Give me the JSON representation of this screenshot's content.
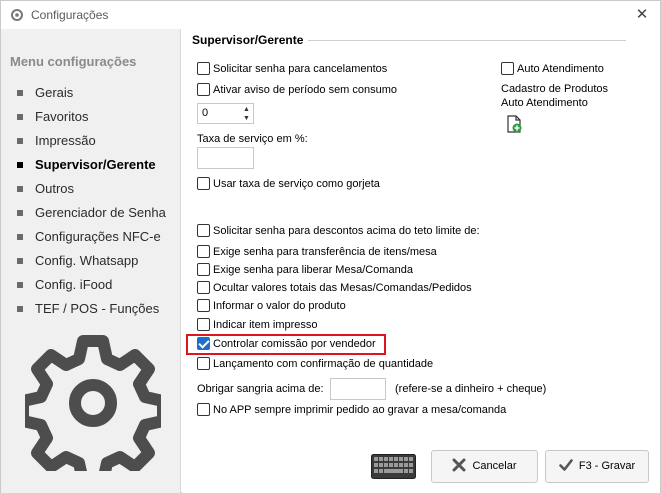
{
  "window": {
    "title": "Configurações",
    "close_glyph": "✕"
  },
  "sidebar": {
    "title": "Menu configurações",
    "items": [
      {
        "label": "Gerais"
      },
      {
        "label": "Favoritos"
      },
      {
        "label": "Impressão"
      },
      {
        "label": "Supervisor/Gerente",
        "active": true
      },
      {
        "label": "Outros"
      },
      {
        "label": "Gerenciador de Senha"
      },
      {
        "label": "Configurações NFC-e"
      },
      {
        "label": "Config. Whatsapp"
      },
      {
        "label": "Config. iFood"
      },
      {
        "label": "TEF / POS - Funções"
      }
    ]
  },
  "main": {
    "section_title": "Supervisor/Gerente",
    "opt_cancel": "Solicitar senha para cancelamentos",
    "opt_period": "Ativar aviso de período sem consumo",
    "period_value": "0",
    "service_rate_label": "Taxa de serviço em %:",
    "service_rate_value": "",
    "opt_tip": "Usar taxa de serviço como gorjeta",
    "opt_auto": "Auto Atendimento",
    "product_reg_line1": "Cadastro de Produtos",
    "product_reg_line2": "Auto Atendimento",
    "opt_discount": "Solicitar senha para descontos acima do teto limite de:",
    "opt_transfer": "Exige senha para transferência de itens/mesa",
    "opt_release": "Exige senha para liberar Mesa/Comanda",
    "opt_hide_totals": "Ocultar valores totais das Mesas/Comandas/Pedidos",
    "opt_product_value": "Informar o valor do produto",
    "opt_printed_item": "Indicar item impresso",
    "opt_commission": "Controlar comissão por vendedor",
    "opt_qty_confirm": "Lançamento com confirmação de quantidade",
    "sangria_label": "Obrigar sangria acima de:",
    "sangria_value": "",
    "sangria_note": "(refere-se a dinheiro  + cheque)",
    "opt_app_print": "No APP sempre imprimir pedido ao gravar a mesa/comanda"
  },
  "checkbox_states": {
    "opt_cancel": false,
    "opt_period": false,
    "opt_tip": false,
    "opt_auto": false,
    "opt_discount": false,
    "opt_transfer": false,
    "opt_release": false,
    "opt_hide_totals": false,
    "opt_product_value": false,
    "opt_printed_item": false,
    "opt_commission": true,
    "opt_qty_confirm": false,
    "opt_app_print": false
  },
  "buttons": {
    "cancel": "Cancelar",
    "save": "F3 - Gravar"
  },
  "colors": {
    "accent": "#1a6fd0",
    "highlight": "#e0141e",
    "cancel_icon": "#555555",
    "sidebar_bg": "#f0f0f0"
  }
}
